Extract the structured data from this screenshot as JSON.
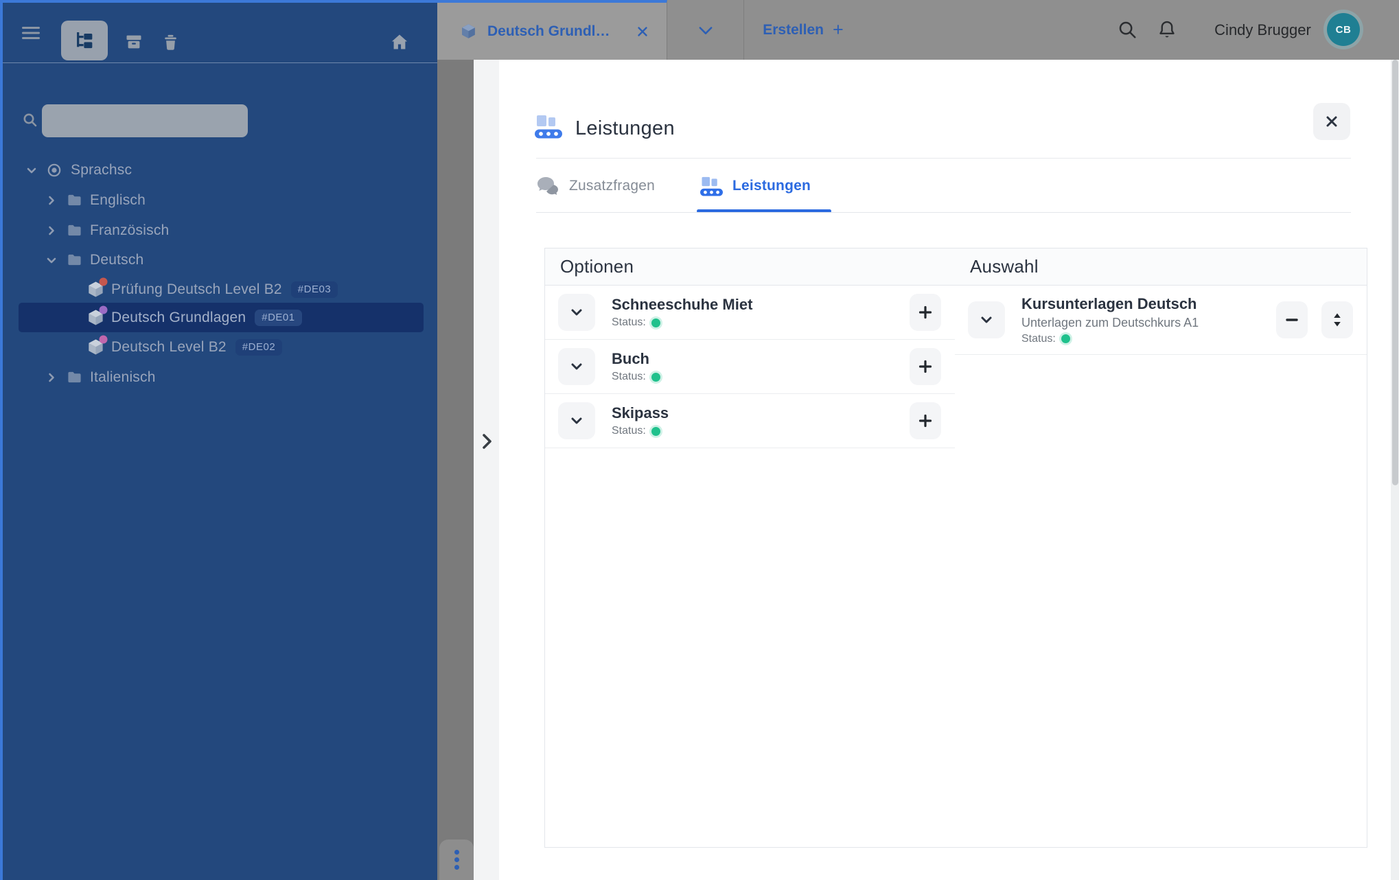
{
  "colors": {
    "accent_blue": "#2b6ae0",
    "dimmed_link_blue": "#2d5fb4",
    "sidebar_blue": "#23487d",
    "sidebar_selected_row": "#15316a",
    "focus_border_blue": "#3c79d8",
    "status_green": "#1fc18c",
    "avatar_teal": "#1f7f93",
    "notification_dot_red": "#c4574e",
    "notification_dot_purple": "#9b6bc4",
    "notification_dot_pink": "#c167ad"
  },
  "sidebar": {
    "toolbar": {
      "icons": [
        "menu-icon",
        "tree-structure-icon",
        "archive-icon",
        "trash-icon",
        "home-icon"
      ],
      "active_tool": "tree-structure"
    },
    "search": {
      "placeholder": "",
      "value": ""
    },
    "tree": [
      {
        "label": "Sprachsc",
        "level": 0,
        "icon": "radio-dot",
        "expanded": true
      },
      {
        "label": "Englisch",
        "level": 1,
        "icon": "folder",
        "expanded": false
      },
      {
        "label": "Französisch",
        "level": 1,
        "icon": "folder",
        "expanded": false
      },
      {
        "label": "Deutsch",
        "level": 1,
        "icon": "folder",
        "expanded": true
      },
      {
        "label": "Prüfung Deutsch Level B2",
        "level": 2,
        "icon": "package",
        "badge": "#DE03",
        "dot_color": "#c4574e"
      },
      {
        "label": "Deutsch Grundlagen",
        "level": 2,
        "icon": "package",
        "badge": "#DE01",
        "dot_color": "#9b6bc4",
        "selected": true
      },
      {
        "label": "Deutsch Level B2",
        "level": 2,
        "icon": "package",
        "badge": "#DE02",
        "dot_color": "#c167ad"
      },
      {
        "label": "Italienisch",
        "level": 1,
        "icon": "folder",
        "expanded": false
      }
    ]
  },
  "topbar": {
    "tab": {
      "label": "Deutsch Grundl…",
      "icon": "package"
    },
    "create_label": "Erstellen",
    "create_plus": "+",
    "user_name": "Cindy Brugger",
    "user_initials": "CB"
  },
  "modal": {
    "title": "Leistungen",
    "tabs": [
      {
        "label": "Zusatzfragen",
        "icon": "chat-bubbles",
        "active": false
      },
      {
        "label": "Leistungen",
        "icon": "conveyor",
        "active": true
      }
    ],
    "optionen": {
      "header": "Optionen",
      "items": [
        {
          "title": "Schneeschuhe Miet",
          "status_label": "Status:",
          "status": "green"
        },
        {
          "title": "Buch",
          "status_label": "Status:",
          "status": "green"
        },
        {
          "title": "Skipass",
          "status_label": "Status:",
          "status": "green"
        }
      ]
    },
    "auswahl": {
      "header": "Auswahl",
      "items": [
        {
          "title": "Kursunterlagen Deutsch",
          "subtitle": "Unterlagen zum Deutschkurs A1",
          "status_label": "Status:",
          "status": "green"
        }
      ]
    }
  }
}
